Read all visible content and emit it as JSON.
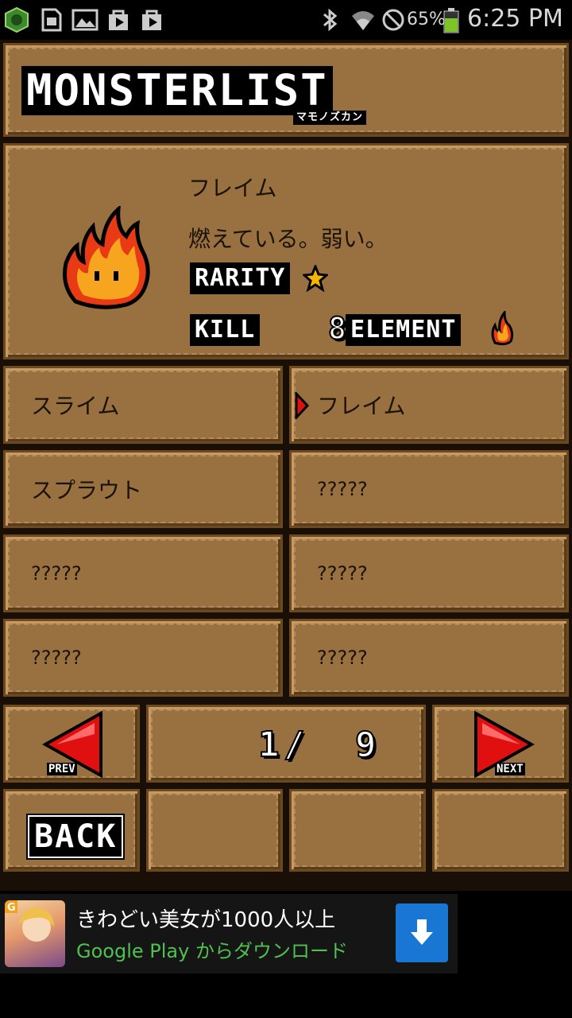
{
  "statusbar": {
    "battery": "65%",
    "time": "6:25 PM",
    "icons": [
      "game-app-icon",
      "sd-card-icon",
      "image-icon",
      "play-store-icon",
      "shopping-bag-icon",
      "bluetooth-icon",
      "wifi-icon",
      "do-not-disturb-icon",
      "battery-icon"
    ]
  },
  "header": {
    "title": "MONSTERLIST",
    "subtitle": "マモノズカン"
  },
  "detail": {
    "name": "フレイム",
    "description": "燃えている。弱い。",
    "rarity_label": "RARITY",
    "kill_label": "KILL",
    "kill_count": "8",
    "element_label": "ELEMENT",
    "rarity_icon": "star-icon",
    "element_icon": "fire-icon",
    "monster_sprite": "flame-monster-sprite"
  },
  "list": {
    "items": [
      {
        "label": "スライム",
        "selected": false
      },
      {
        "label": "フレイム",
        "selected": true
      },
      {
        "label": "スプラウト",
        "selected": false
      },
      {
        "label": "?????",
        "selected": false
      },
      {
        "label": "?????",
        "selected": false
      },
      {
        "label": "?????",
        "selected": false
      },
      {
        "label": "?????",
        "selected": false
      },
      {
        "label": "?????",
        "selected": false
      }
    ]
  },
  "pager": {
    "prev_label": "PREV",
    "next_label": "NEXT",
    "current": "1",
    "separator": "/",
    "total": "9"
  },
  "back_label": "BACK",
  "ad": {
    "title": "きわどい美女が1000人以上",
    "subtitle": "Google Play からダウンロード",
    "download_icon": "download-arrow-icon"
  },
  "colors": {
    "panel": "#99703f",
    "arrow": "#e01010",
    "ad_accent": "#1976d2"
  }
}
